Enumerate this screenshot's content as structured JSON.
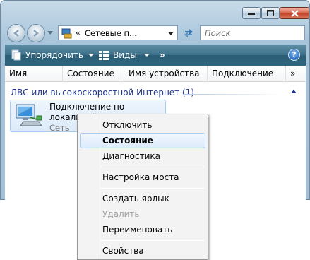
{
  "window": {
    "address_prefix": "«",
    "address_text": "Сетевые п...",
    "search_placeholder": "Поиск"
  },
  "toolbar": {
    "organize_label": "Упорядочить",
    "views_label": "Виды",
    "more_label": "»",
    "help_label": "?"
  },
  "columns": [
    {
      "label": "Имя"
    },
    {
      "label": "Состояние"
    },
    {
      "label": "Имя устройства"
    },
    {
      "label": "Подключение"
    },
    {
      "label": "»"
    }
  ],
  "group": {
    "label": "ЛВС или высокоскоростной Интернет (1)"
  },
  "item": {
    "name": "Подключение по локальной сети",
    "subtitle": "Сеть"
  },
  "context_menu": {
    "items": [
      {
        "label": "Отключить"
      },
      {
        "label": "Состояние"
      },
      {
        "label": "Диагностика"
      },
      {
        "label": "Настройка моста"
      },
      {
        "label": "Создать ярлык"
      },
      {
        "label": "Удалить"
      },
      {
        "label": "Переименовать"
      },
      {
        "label": "Свойства"
      }
    ]
  }
}
